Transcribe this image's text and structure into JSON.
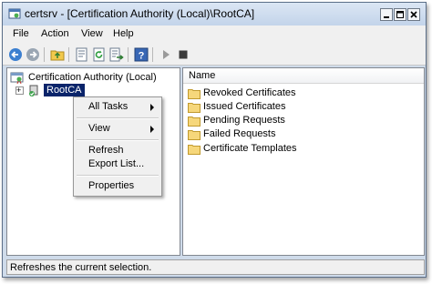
{
  "window": {
    "title": "certsrv - [Certification Authority (Local)\\RootCA]",
    "minimize_icon": "minimize-icon",
    "restore_icon": "restore-icon",
    "close_icon": "close-icon"
  },
  "menu": {
    "items": [
      "File",
      "Action",
      "View",
      "Help"
    ]
  },
  "toolbar": {
    "icons": [
      "back-icon",
      "forward-icon",
      "up-folder-icon",
      "properties-icon",
      "refresh-icon",
      "export-list-icon",
      "help-icon",
      "play-icon",
      "stop-icon"
    ]
  },
  "tree": {
    "root_label": "Certification Authority (Local)",
    "ca_label": "RootCA",
    "expand_symbol": "+"
  },
  "list": {
    "column_header": "Name",
    "items": [
      "Revoked Certificates",
      "Issued Certificates",
      "Pending Requests",
      "Failed Requests",
      "Certificate Templates"
    ]
  },
  "context_menu": {
    "items": [
      {
        "label": "All Tasks",
        "submenu": true
      },
      {
        "label": "View",
        "submenu": true
      },
      {
        "label": "Refresh",
        "submenu": false
      },
      {
        "label": "Export List...",
        "submenu": false
      },
      {
        "label": "Properties",
        "submenu": false
      }
    ]
  },
  "status": {
    "text": "Refreshes the current selection."
  },
  "colors": {
    "selection": "#0a246a",
    "title_gradient": "#c3d4ea",
    "folder": "#f6d77b"
  }
}
